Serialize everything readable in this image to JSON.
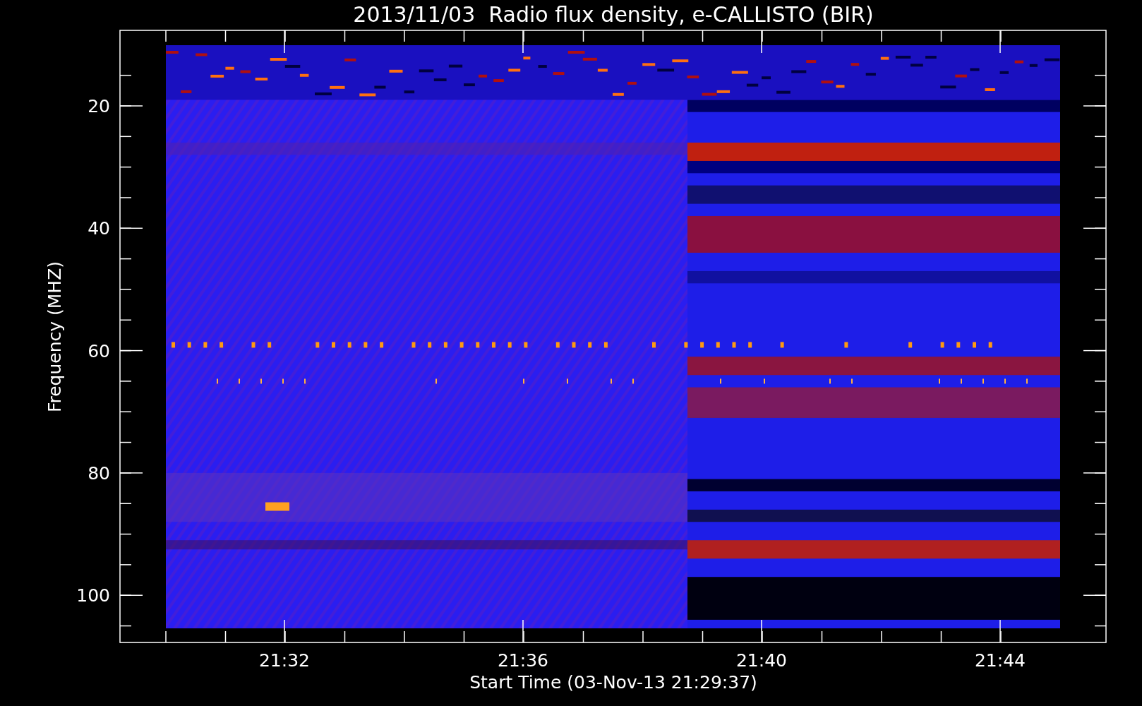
{
  "title": "2013/11/03  Radio flux density, e-CALLISTO (BIR)",
  "y_axis": {
    "label": "Frequency (MHZ)",
    "ticks": [
      "20",
      "40",
      "60",
      "80",
      "100"
    ]
  },
  "x_axis": {
    "label": "Start Time (03-Nov-13 21:29:37)",
    "ticks": [
      "21:32",
      "21:36",
      "21:40",
      "21:44"
    ]
  }
}
